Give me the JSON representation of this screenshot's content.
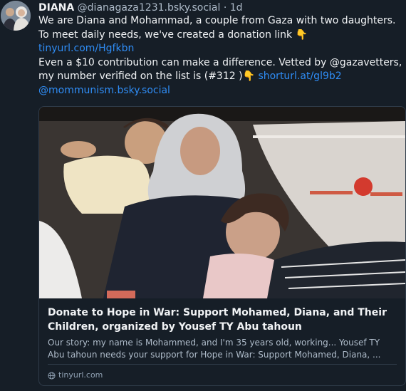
{
  "post": {
    "author": "DIANA",
    "handle": "@dianagaza1231.bsky.social",
    "separator": "·",
    "time": "1d",
    "text_line1": "We are Diana and Mohammad, a couple from Gaza with two daughters. To meet daily needs, we've created a donation link",
    "emoji_point": "👇",
    "link1": "tinyurl.com/Hgfkbn",
    "text_line2": "Even a $10 contribution can make a difference. Vetted by @gazavetters, my number verified on the list is (#312 )",
    "link2": "shorturl.at/gl9b2",
    "mention": "@mommunism.bsky.social"
  },
  "card": {
    "image_alt": "Photo of a mother in a hijab with two young daughters inside a car",
    "title": "Donate to Hope in War: Support Mohamed, Diana, and Their Children, organized by Yousef TY Abu tahoun",
    "description": "Our story: my name is Mohammed, and I'm 35 years old, working... Yousef TY Abu tahoun needs your support for Hope in War: Support Mohamed, Diana, ...",
    "domain": "tinyurl.com"
  },
  "colors": {
    "background": "#161e27",
    "link": "#2f8cf4",
    "muted": "#aebbc9",
    "border": "#2f3b49"
  }
}
